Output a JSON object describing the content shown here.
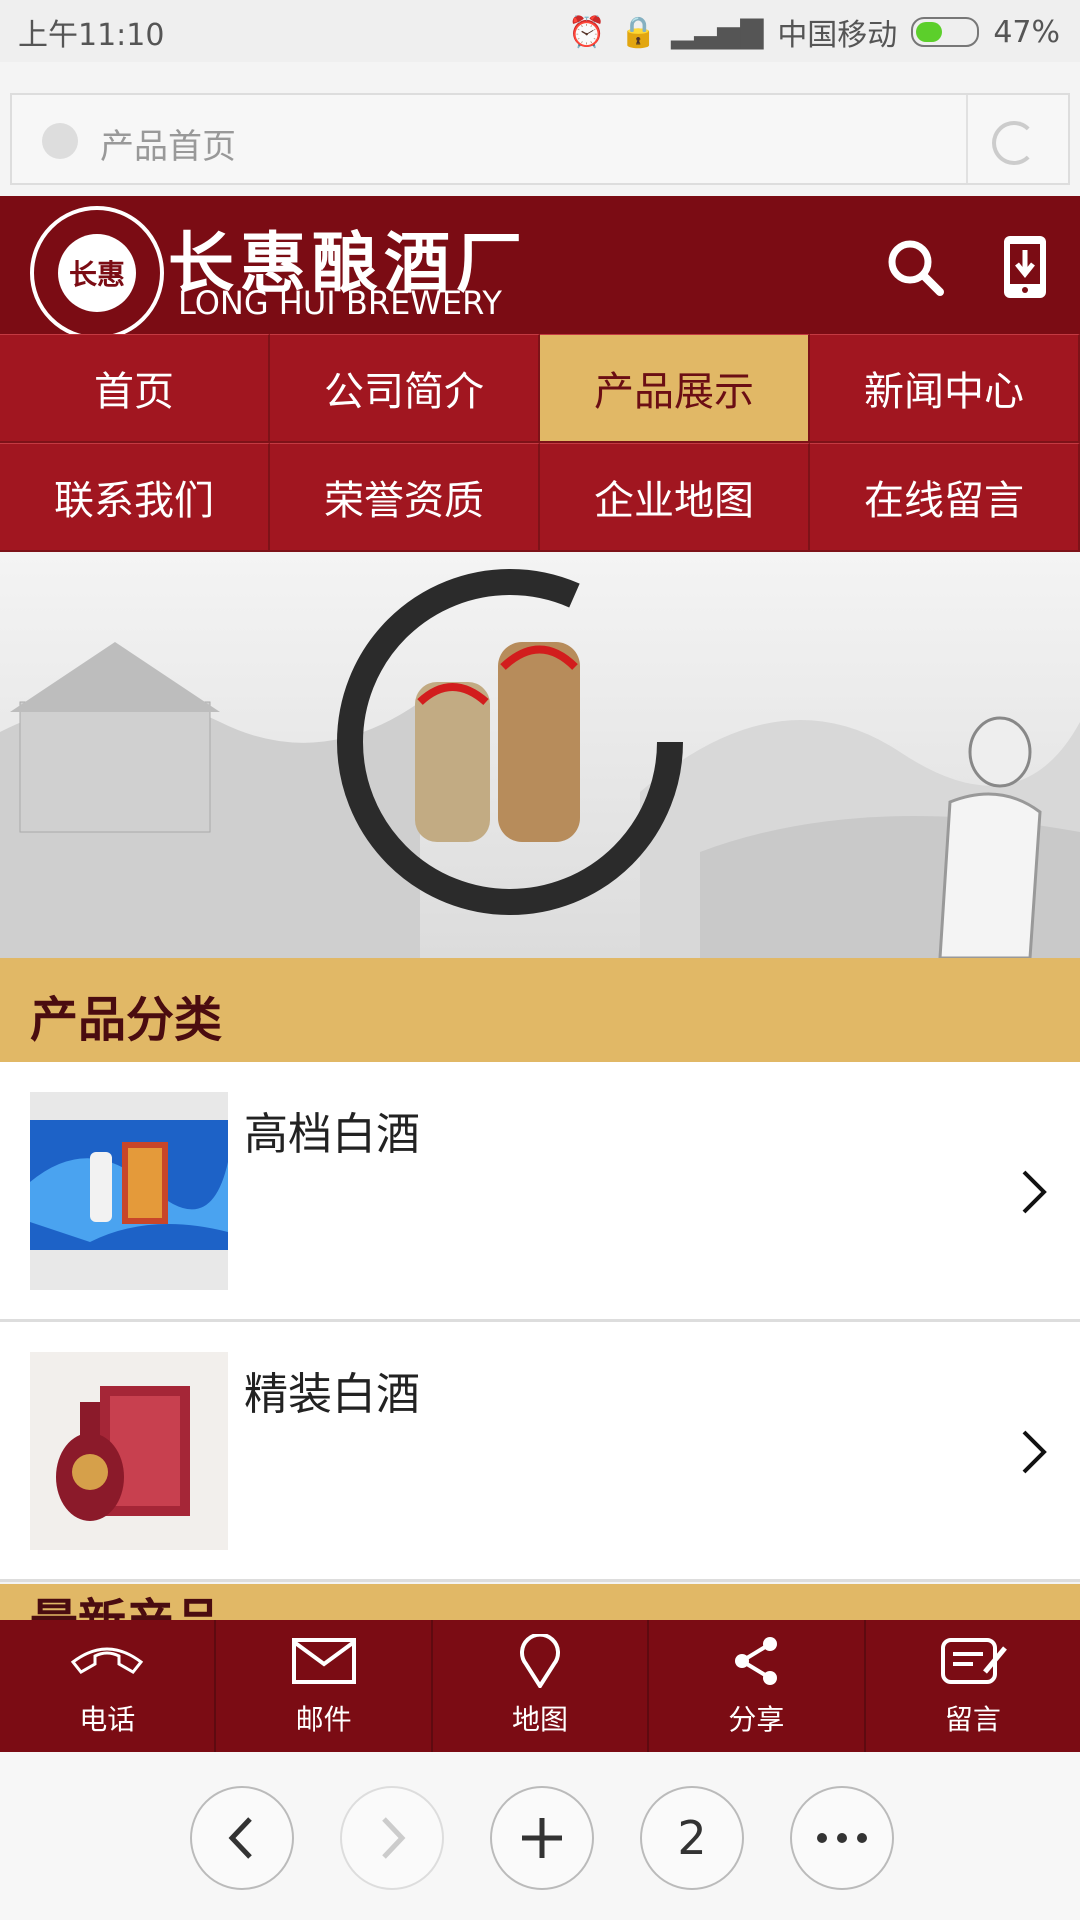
{
  "status_bar": {
    "time": "上午11:10",
    "carrier": "中国移动",
    "battery": "47%",
    "battery_level": 0.47
  },
  "url_bar": {
    "title": "产品首页"
  },
  "header": {
    "logo_text": "长惠",
    "site_name_cn": "长惠酿酒厂",
    "site_name_en": "LONG HUI BREWERY"
  },
  "nav": {
    "items": [
      {
        "label": "首页"
      },
      {
        "label": "公司简介"
      },
      {
        "label": "产品展示",
        "active": true
      },
      {
        "label": "新闻中心"
      },
      {
        "label": "联系我们"
      },
      {
        "label": "荣誉资质"
      },
      {
        "label": "企业地图"
      },
      {
        "label": "在线留言"
      }
    ]
  },
  "category_section": {
    "title": "产品分类",
    "items": [
      {
        "name": "高档白酒"
      },
      {
        "name": "精装白酒"
      }
    ]
  },
  "latest_section": {
    "title": "最新产品"
  },
  "action_bar": {
    "items": [
      {
        "label": "电话",
        "icon": "phone-icon"
      },
      {
        "label": "邮件",
        "icon": "mail-icon"
      },
      {
        "label": "地图",
        "icon": "map-pin-icon"
      },
      {
        "label": "分享",
        "icon": "share-icon"
      },
      {
        "label": "留言",
        "icon": "message-icon"
      }
    ]
  },
  "browser_toolbar": {
    "tab_count": "2"
  },
  "colors": {
    "brand_dark": "#7b0c14",
    "nav_red": "#a11620",
    "gold": "#e1b866"
  }
}
